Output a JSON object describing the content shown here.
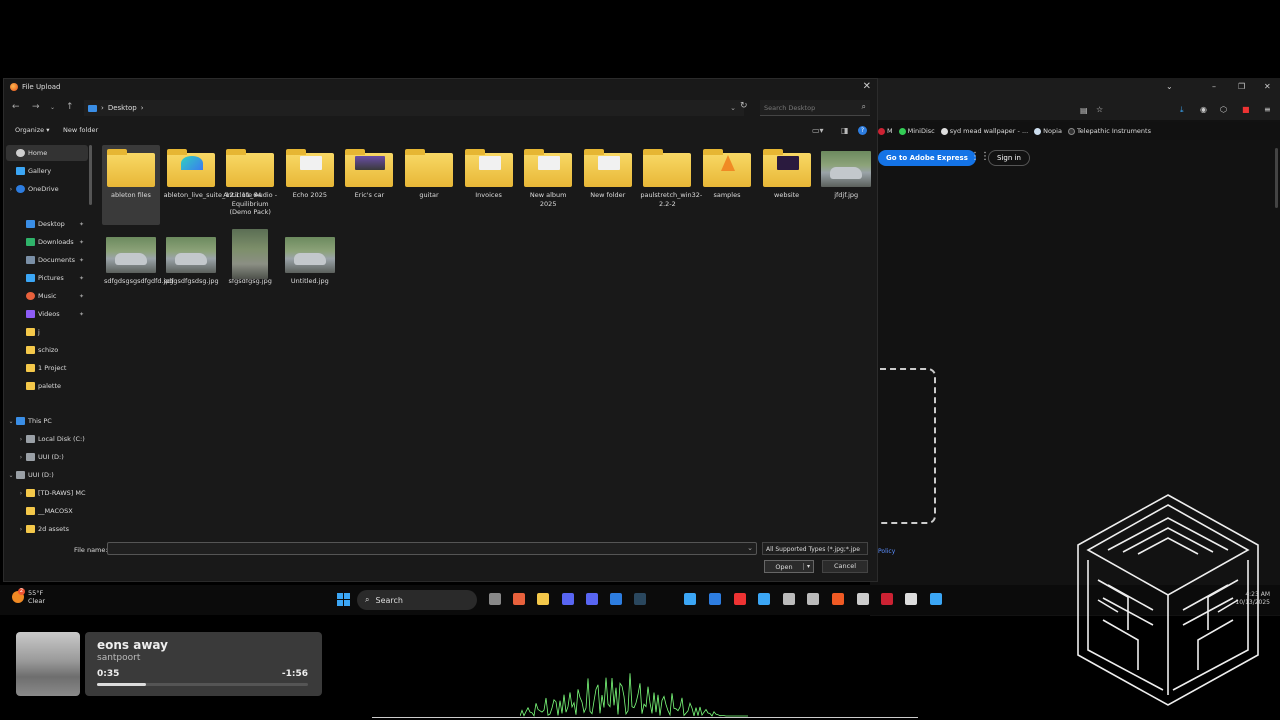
{
  "browser": {
    "bookmarks": [
      "M",
      "MiniDisc",
      "syd mead wallpaper - ...",
      "Nopia",
      "Telepathic Instruments"
    ],
    "adobe_button": "Go to Adobe Express",
    "signin_button": "Sign in",
    "policy_text": "Policy"
  },
  "dialog": {
    "title": "File Upload",
    "breadcrumb": "Desktop",
    "search_placeholder": "Search Desktop",
    "organize_label": "Organize",
    "new_folder_label": "New folder",
    "nav_items": [
      {
        "label": "Home",
        "type": "home"
      },
      {
        "label": "Gallery",
        "type": "gallery"
      },
      {
        "label": "OneDrive",
        "type": "onedrive"
      },
      {
        "label": "Desktop",
        "type": "desktop"
      },
      {
        "label": "Downloads",
        "type": "downloads"
      },
      {
        "label": "Documents",
        "type": "documents"
      },
      {
        "label": "Pictures",
        "type": "pictures"
      },
      {
        "label": "Music",
        "type": "music"
      },
      {
        "label": "Videos",
        "type": "videos"
      },
      {
        "label": "j",
        "type": "folder"
      },
      {
        "label": "schizo",
        "type": "folder"
      },
      {
        "label": "1 Project",
        "type": "folder"
      },
      {
        "label": "palette",
        "type": "folder"
      },
      {
        "label": "This PC",
        "type": "pc"
      },
      {
        "label": "Local Disk (C:)",
        "type": "drive"
      },
      {
        "label": "UUI (D:)",
        "type": "drive"
      },
      {
        "label": "UUI (D:)",
        "type": "drive"
      },
      {
        "label": "[TD-RAWS] MC",
        "type": "folder"
      },
      {
        "label": "__MACOSX",
        "type": "folder"
      },
      {
        "label": "2d assets",
        "type": "folder"
      }
    ],
    "files": [
      {
        "name": "ableton files",
        "kind": "folder"
      },
      {
        "name": "ableton_live_suite_12.1.11_64",
        "kind": "folder-ableton"
      },
      {
        "name": "Anticlote Audio - Equilibrium (Demo Pack)",
        "kind": "folder"
      },
      {
        "name": "Echo 2025",
        "kind": "folder-docs"
      },
      {
        "name": "Eric's car",
        "kind": "folder-car"
      },
      {
        "name": "guitar",
        "kind": "folder"
      },
      {
        "name": "Invoices",
        "kind": "folder-docs"
      },
      {
        "name": "New album 2025",
        "kind": "folder-docs"
      },
      {
        "name": "New folder",
        "kind": "folder-docs"
      },
      {
        "name": "paulstretch_win32-2.2-2",
        "kind": "folder"
      },
      {
        "name": "samples",
        "kind": "folder-vlc"
      },
      {
        "name": "website",
        "kind": "folder-dark"
      },
      {
        "name": "jfdjf.jpg",
        "kind": "photo"
      },
      {
        "name": "sdfgdsgsgsdfgdfd.jpg",
        "kind": "photo"
      },
      {
        "name": "sdfgsdfgsdsg.jpg",
        "kind": "photo"
      },
      {
        "name": "sfgsdfgsg.jpg",
        "kind": "photo-tall"
      },
      {
        "name": "Untitled.jpg",
        "kind": "photo"
      }
    ],
    "filename_label": "File name:",
    "filename_value": "",
    "filetype_value": "All Supported Types (*.jpg;*.jpe",
    "open_label": "Open",
    "cancel_label": "Cancel"
  },
  "taskbar": {
    "temperature": "55°F",
    "condition": "Clear",
    "weather_badge": "2",
    "search_label": "Search",
    "time": "4:23 AM",
    "date": "10/13/2025"
  },
  "media": {
    "title": "eons away",
    "artist": "santpoort",
    "elapsed": "0:35",
    "remaining": "-1:56",
    "progress": 0.23
  },
  "colors": {
    "accent": "#2d7de0",
    "folder": "#f4c84a",
    "adobe": "#1473e6",
    "wave": "#7cff7c"
  }
}
